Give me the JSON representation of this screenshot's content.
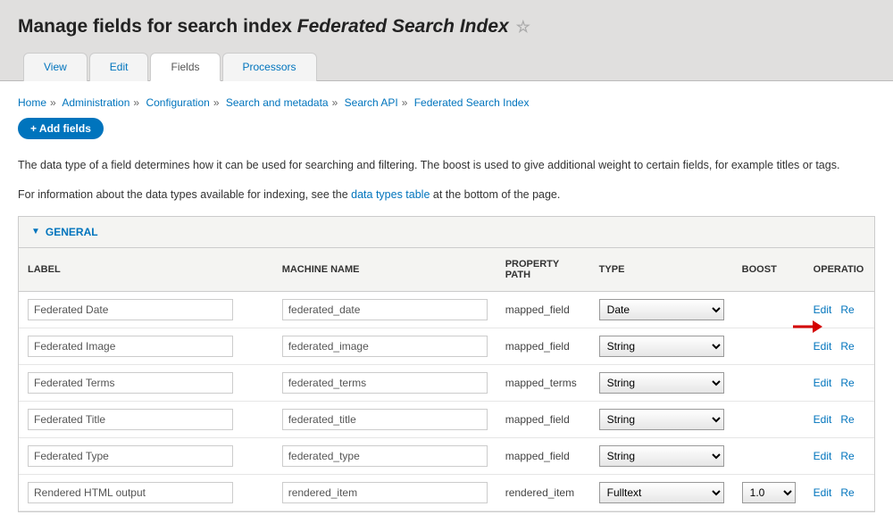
{
  "title_prefix": "Manage fields for search index ",
  "title_index": "Federated Search Index",
  "tabs": {
    "view": "View",
    "edit": "Edit",
    "fields": "Fields",
    "processors": "Processors"
  },
  "breadcrumb": {
    "home": "Home",
    "admin": "Administration",
    "config": "Configuration",
    "meta": "Search and metadata",
    "api": "Search API",
    "idx": "Federated Search Index"
  },
  "add_fields": "+ Add fields",
  "intro1": "The data type of a field determines how it can be used for searching and filtering. The boost is used to give additional weight to certain fields, for example titles or tags.",
  "intro2a": "For information about the data types available for indexing, see the ",
  "intro2_link": "data types table",
  "intro2b": " at the bottom of the page.",
  "section": "GENERAL",
  "headers": {
    "label": "LABEL",
    "machine": "MACHINE NAME",
    "path": "PROPERTY PATH",
    "type": "TYPE",
    "boost": "BOOST",
    "ops": "OPERATIO"
  },
  "ops": {
    "edit": "Edit",
    "remove": "Re"
  },
  "rows": [
    {
      "label": "Federated Date",
      "machine": "federated_date",
      "path": "mapped_field",
      "type": "Date",
      "boost": ""
    },
    {
      "label": "Federated Image",
      "machine": "federated_image",
      "path": "mapped_field",
      "type": "String",
      "boost": ""
    },
    {
      "label": "Federated Terms",
      "machine": "federated_terms",
      "path": "mapped_terms",
      "type": "String",
      "boost": ""
    },
    {
      "label": "Federated Title",
      "machine": "federated_title",
      "path": "mapped_field",
      "type": "String",
      "boost": ""
    },
    {
      "label": "Federated Type",
      "machine": "federated_type",
      "path": "mapped_field",
      "type": "String",
      "boost": ""
    },
    {
      "label": "Rendered HTML output",
      "machine": "rendered_item",
      "path": "rendered_item",
      "type": "Fulltext",
      "boost": "1.0"
    }
  ]
}
